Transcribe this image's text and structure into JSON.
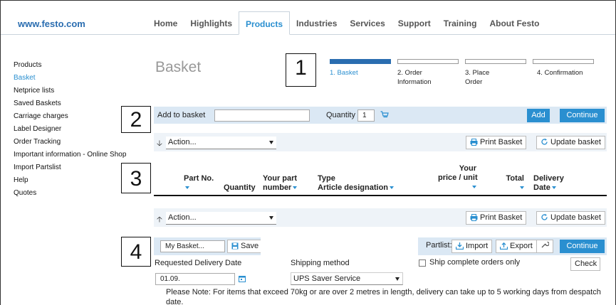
{
  "site": {
    "logo": "www.festo.com"
  },
  "nav": [
    {
      "label": "Home"
    },
    {
      "label": "Highlights"
    },
    {
      "label": "Products",
      "active": true
    },
    {
      "label": "Industries"
    },
    {
      "label": "Services"
    },
    {
      "label": "Support"
    },
    {
      "label": "Training"
    },
    {
      "label": "About Festo"
    }
  ],
  "sidebar": [
    {
      "label": "Products"
    },
    {
      "label": "Basket",
      "active": true
    },
    {
      "label": "Netprice lists"
    },
    {
      "label": "Saved Baskets"
    },
    {
      "label": "Carriage charges"
    },
    {
      "label": "Label Designer"
    },
    {
      "label": "Order Tracking"
    },
    {
      "label": "Important information - Online Shop"
    },
    {
      "label": "Import Partslist"
    },
    {
      "label": "Help"
    },
    {
      "label": "Quotes"
    }
  ],
  "page": {
    "title": "Basket"
  },
  "steps": [
    {
      "line1": "1. Basket",
      "line2": "",
      "active": true
    },
    {
      "line1": "2. Order",
      "line2": "Information"
    },
    {
      "line1": "3. Place",
      "line2": "Order"
    },
    {
      "line1": "4. Confirmation",
      "line2": ""
    }
  ],
  "callouts": [
    "1",
    "2",
    "3",
    "4"
  ],
  "add_bar": {
    "label": "Add to basket",
    "input_value": "",
    "quantity_label": "Quantity",
    "quantity_value": "1",
    "add_button": "Add",
    "continue_button": "Continue"
  },
  "action_bar_top": {
    "select": "Action...",
    "print_button": "Print Basket",
    "update_button": "Update basket"
  },
  "table_header": {
    "part_no": "Part No.",
    "quantity": "Quantity",
    "your_part_1": "Your part",
    "your_part_2": "number",
    "type_1": "Type",
    "type_2": "Article designation",
    "your_1": "Your",
    "your_2": "price / unit",
    "total": "Total",
    "delivery_1": "Delivery",
    "delivery_2": "Date"
  },
  "action_bar_bottom": {
    "select": "Action...",
    "print_button": "Print Basket",
    "update_button": "Update basket"
  },
  "save_bar": {
    "basket_name": "My Basket...",
    "save_button": "Save",
    "partlist_label": "Partlist:",
    "import_button": "Import",
    "export_button": "Export",
    "continue_button": "Continue"
  },
  "delivery": {
    "requested_label": "Requested Delivery Date",
    "date_value": "01.09.",
    "shipping_label": "Shipping method",
    "shipping_value": "UPS Saver Service",
    "ship_complete_label": "Ship complete orders only",
    "check_button": "Check",
    "note": "Please Note: For items that exceed 70kg or are over 2 metres in length, delivery can take up to 5 working days from despatch date."
  },
  "colors": {
    "accent": "#2a8fd0",
    "bar": "#dbe8f4",
    "logo": "#2a6db0"
  }
}
